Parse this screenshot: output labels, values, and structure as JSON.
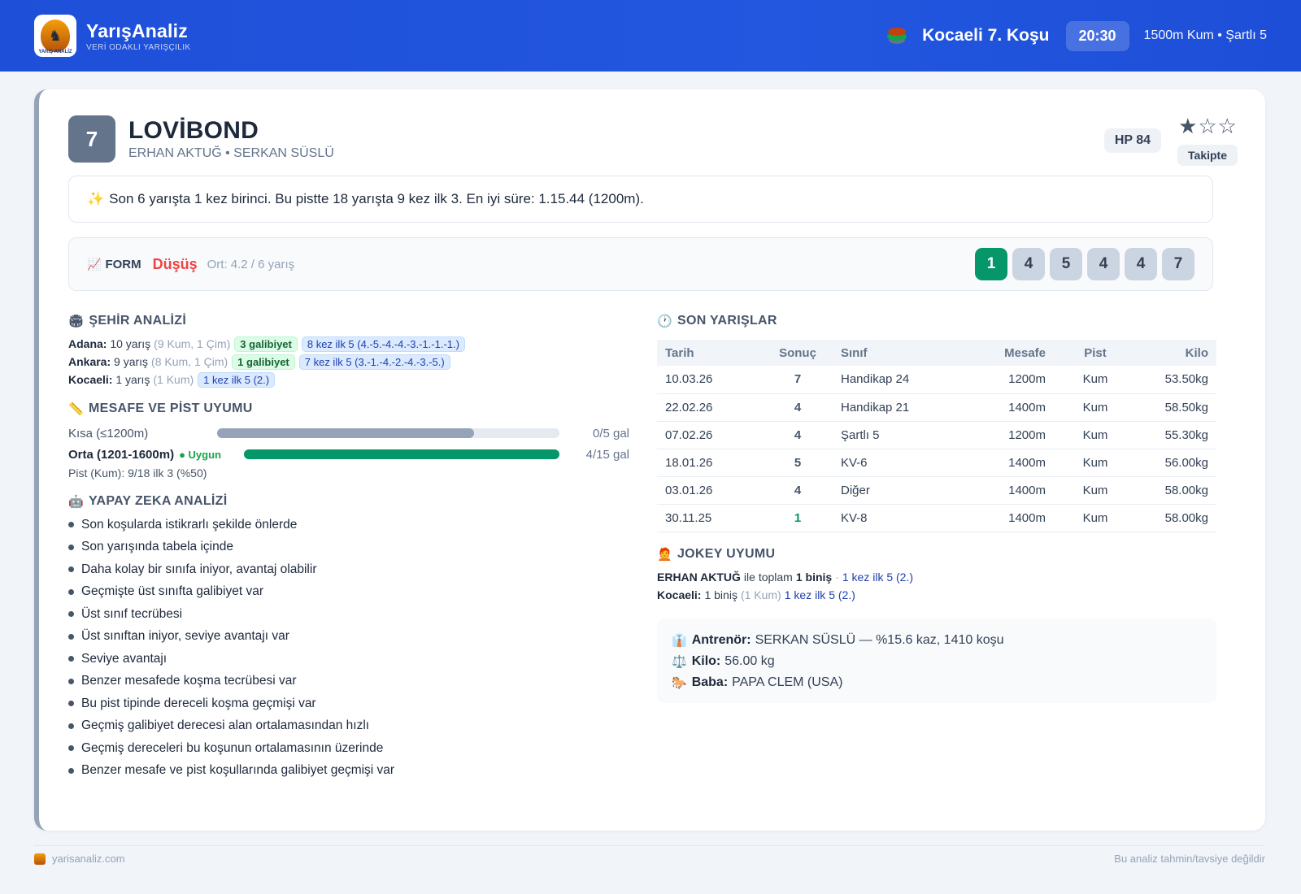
{
  "brand": {
    "name": "YarışAnaliz",
    "tagline": "VERİ ODAKLI YARIŞÇILIK",
    "logo_text": "YARIŞ ANALİZ"
  },
  "race": {
    "title": "Kocaeli 7. Koşu",
    "time": "20:30",
    "detail": "1500m Kum • Şartlı 5"
  },
  "horse": {
    "number": "7",
    "name": "LOVİBOND",
    "people": "ERHAN AKTUĞ • SERKAN SÜSLÜ",
    "hp": "HP 84",
    "rating_of_3": 1,
    "stars": "★☆☆",
    "follow_label": "Takipte"
  },
  "summary": {
    "icon": "sparkles-icon",
    "text": "Son 6 yarışta 1 kez birinci. Bu pistte 18 yarışta 9 kez ilk 3. En iyi süre: 1.15.44 (1200m)."
  },
  "form": {
    "label": "FORM",
    "trend": "Düşüş",
    "avg": "Ort: 4.2 / 6 yarış",
    "results": [
      "1",
      "4",
      "5",
      "4",
      "4",
      "7"
    ]
  },
  "city": {
    "title": "ŞEHİR ANALİZİ",
    "rows": [
      {
        "city": "Adana:",
        "count": "10 yarış",
        "detail": "(9 Kum, 1 Çim)",
        "win": "3 galibiyet",
        "top5": "8 kez ilk 5 (4.-5.-4.-4.-3.-1.-1.-1.)"
      },
      {
        "city": "Ankara:",
        "count": "9 yarış",
        "detail": "(8 Kum, 1 Çim)",
        "win": "1 galibiyet",
        "top5": "7 kez ilk 5 (3.-1.-4.-2.-4.-3.-5.)"
      },
      {
        "city": "Kocaeli:",
        "count": "1 yarış",
        "detail": "(1 Kum)",
        "win": "",
        "top5": "1 kez ilk 5 (2.)"
      }
    ]
  },
  "distance": {
    "title": "MESAFE VE PİST UYUMU",
    "rows": [
      {
        "label": "Kısa (≤1200m)",
        "badge": "",
        "fill": 0.75,
        "color": "#94a3b8",
        "value": "0/5 gal"
      },
      {
        "label": "Orta (1201-1600m)",
        "badge": "Uygun",
        "fill": 1.0,
        "color": "#059669",
        "value": "4/15 gal"
      }
    ],
    "pist": "Pist (Kum): 9/18 ilk 3 (%50)"
  },
  "ai": {
    "title": "YAPAY ZEKA ANALİZİ",
    "items": [
      "Son koşularda istikrarlı şekilde önlerde",
      "Son yarışında tabela içinde",
      "Daha kolay bir sınıfa iniyor, avantaj olabilir",
      "Geçmişte üst sınıfta galibiyet var",
      "Üst sınıf tecrübesi",
      "Üst sınıftan iniyor, seviye avantajı var",
      "Seviye avantajı",
      "Benzer mesafede koşma tecrübesi var",
      "Bu pist tipinde dereceli koşma geçmişi var",
      "Geçmiş galibiyet derecesi alan ortalamasından hızlı",
      "Geçmiş dereceleri bu koşunun ortalamasının üzerinde",
      "Benzer mesafe ve pist koşullarında galibiyet geçmişi var"
    ]
  },
  "recent": {
    "title": "SON YARIŞLAR",
    "headers": [
      "Tarih",
      "Sonuç",
      "Sınıf",
      "Mesafe",
      "Pist",
      "Kilo"
    ],
    "rows": [
      [
        "10.03.26",
        "7",
        "Handikap 24",
        "1200m",
        "Kum",
        "53.50kg"
      ],
      [
        "22.02.26",
        "4",
        "Handikap 21",
        "1400m",
        "Kum",
        "58.50kg"
      ],
      [
        "07.02.26",
        "4",
        "Şartlı 5",
        "1200m",
        "Kum",
        "55.30kg"
      ],
      [
        "18.01.26",
        "5",
        "KV-6",
        "1400m",
        "Kum",
        "56.00kg"
      ],
      [
        "03.01.26",
        "4",
        "Diğer",
        "1400m",
        "Kum",
        "58.00kg"
      ],
      [
        "30.11.25",
        "1",
        "KV-8",
        "1400m",
        "Kum",
        "58.00kg"
      ]
    ]
  },
  "jokey": {
    "title": "JOKEY UYUMU",
    "line1": {
      "name": "ERHAN AKTUĞ",
      "mid": "ile toplam",
      "rides": "1 biniş",
      "sep": "·",
      "top5": "1 kez ilk 5 (2.)"
    },
    "line2": {
      "city": "Kocaeli:",
      "rides": "1 biniş",
      "detail": "(1 Kum)",
      "top5": "1 kez ilk 5 (2.)"
    }
  },
  "info": {
    "trainer_label": "Antrenör:",
    "trainer": "SERKAN SÜSLÜ — %15.6 kaz, 1410 koşu",
    "weight_label": "Kilo:",
    "weight": "56.00 kg",
    "sire_label": "Baba:",
    "sire": "PAPA CLEM (USA)"
  },
  "footer": {
    "site": "yarisanaliz.com",
    "disclaimer": "Bu analiz tahmin/tavsiye değildir"
  },
  "colors": {
    "header": "#1e4fd8",
    "win": "#059669",
    "trend_down": "#ef4444"
  }
}
